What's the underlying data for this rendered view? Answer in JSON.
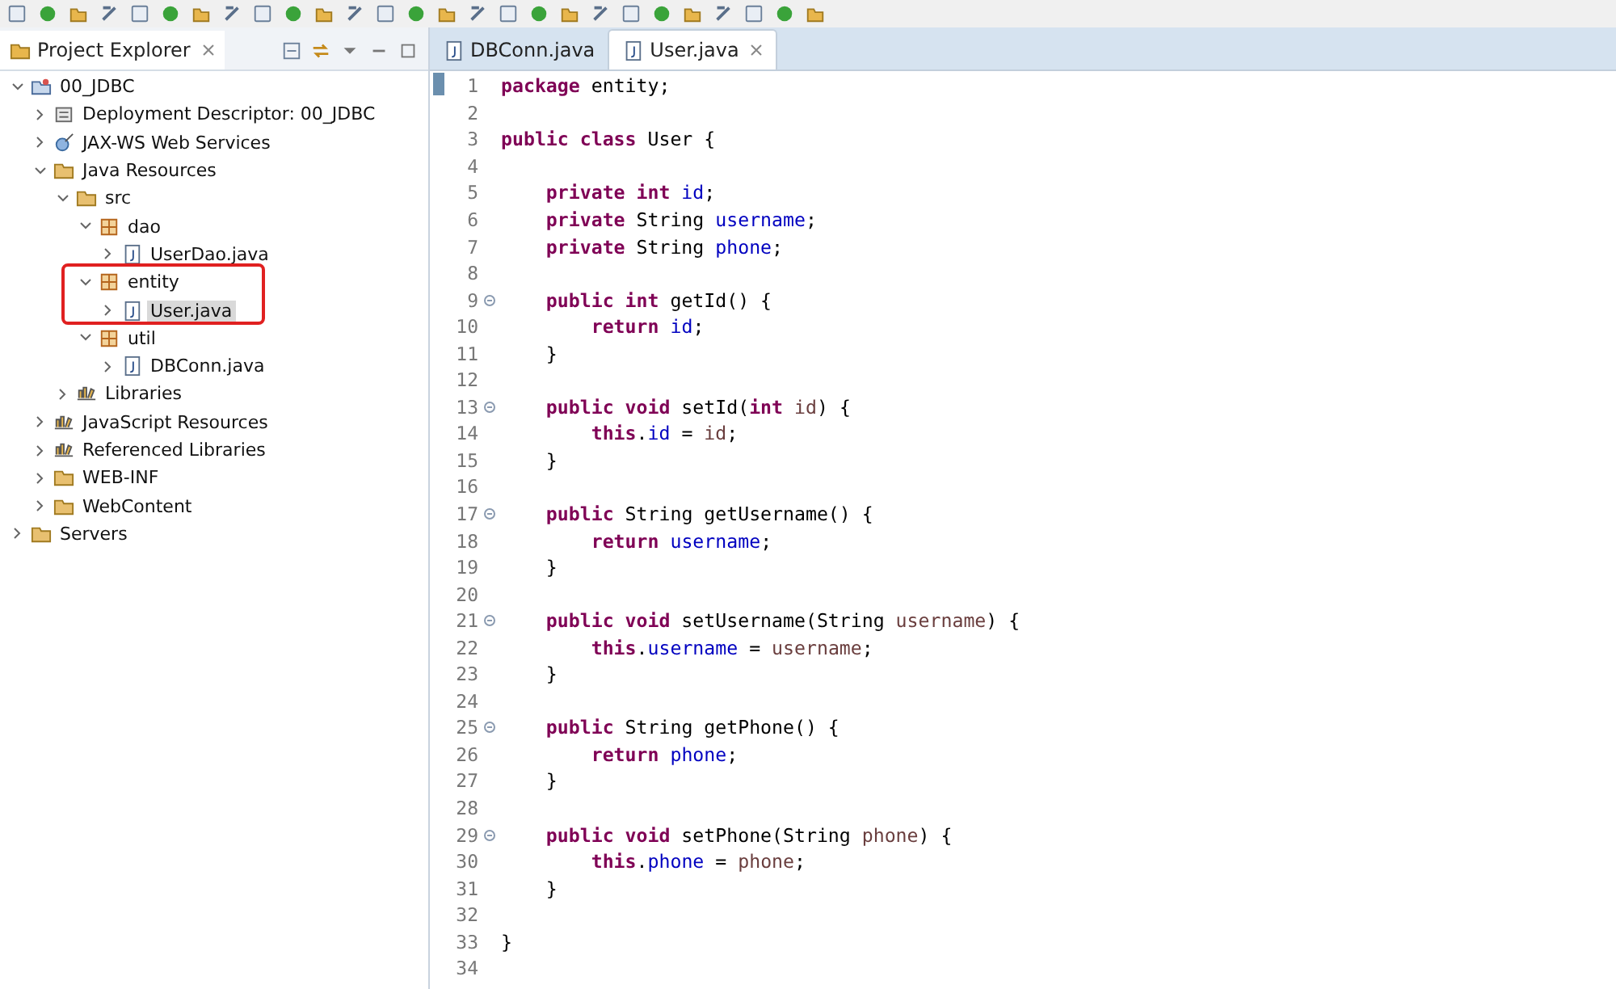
{
  "explorer": {
    "title": "Project Explorer",
    "tree": [
      {
        "label": "00_JDBC",
        "kind": "project",
        "expanded": true,
        "selected": false,
        "children": [
          {
            "label": "Deployment Descriptor: 00_JDBC",
            "kind": "descriptor",
            "expanded": false,
            "selected": false
          },
          {
            "label": "JAX-WS Web Services",
            "kind": "webservice",
            "expanded": false,
            "selected": false
          },
          {
            "label": "Java Resources",
            "kind": "folder",
            "expanded": true,
            "selected": false,
            "children": [
              {
                "label": "src",
                "kind": "folder",
                "expanded": true,
                "selected": false,
                "children": [
                  {
                    "label": "dao",
                    "kind": "package",
                    "expanded": true,
                    "selected": false,
                    "children": [
                      {
                        "label": "UserDao.java",
                        "kind": "file",
                        "expanded": false,
                        "selected": false
                      }
                    ]
                  },
                  {
                    "label": "entity",
                    "kind": "package",
                    "expanded": true,
                    "selected": false,
                    "children": [
                      {
                        "label": "User.java",
                        "kind": "file",
                        "expanded": false,
                        "selected": true
                      }
                    ]
                  },
                  {
                    "label": "util",
                    "kind": "package",
                    "expanded": true,
                    "selected": false,
                    "children": [
                      {
                        "label": "DBConn.java",
                        "kind": "file",
                        "expanded": false,
                        "selected": false
                      }
                    ]
                  }
                ]
              },
              {
                "label": "Libraries",
                "kind": "library",
                "expanded": false,
                "selected": false
              }
            ]
          },
          {
            "label": "JavaScript Resources",
            "kind": "library",
            "expanded": false,
            "selected": false
          },
          {
            "label": "Referenced Libraries",
            "kind": "library",
            "expanded": false,
            "selected": false
          },
          {
            "label": "WEB-INF",
            "kind": "folder",
            "expanded": false,
            "selected": false
          },
          {
            "label": "WebContent",
            "kind": "folder",
            "expanded": false,
            "selected": false
          }
        ]
      },
      {
        "label": "Servers",
        "kind": "folder",
        "expanded": false,
        "selected": false
      }
    ]
  },
  "editor": {
    "tabs": [
      {
        "label": "DBConn.java",
        "selected": false
      },
      {
        "label": "User.java",
        "selected": true
      }
    ],
    "lines": [
      {
        "n": "1",
        "fold": false,
        "segs": [
          {
            "t": "package",
            "kind": "kw"
          },
          {
            "t": " entity;",
            "kind": "plain"
          }
        ]
      },
      {
        "n": "2",
        "fold": false
      },
      {
        "n": "3",
        "fold": false,
        "segs": [
          {
            "t": "public class",
            "kind": "kw"
          },
          {
            "t": " User {",
            "kind": "plain"
          }
        ]
      },
      {
        "n": "4",
        "fold": false
      },
      {
        "n": "5",
        "fold": false,
        "segs": [
          {
            "t": "    private int",
            "kind": "kw"
          },
          {
            "t": " id",
            "kind": "field"
          },
          {
            "t": ";",
            "kind": "plain"
          }
        ]
      },
      {
        "n": "6",
        "fold": false,
        "segs": [
          {
            "t": "    private",
            "kind": "kw"
          },
          {
            "t": " String",
            "kind": "plain"
          },
          {
            "t": " username",
            "kind": "field"
          },
          {
            "t": ";",
            "kind": "plain"
          }
        ]
      },
      {
        "n": "7",
        "fold": false,
        "segs": [
          {
            "t": "    private",
            "kind": "kw"
          },
          {
            "t": " String",
            "kind": "plain"
          },
          {
            "t": " phone",
            "kind": "field"
          },
          {
            "t": ";",
            "kind": "plain"
          }
        ]
      },
      {
        "n": "8",
        "fold": false
      },
      {
        "n": "9",
        "fold": true,
        "segs": [
          {
            "t": "    public int",
            "kind": "kw"
          },
          {
            "t": " getId() {",
            "kind": "plain"
          }
        ]
      },
      {
        "n": "10",
        "fold": false,
        "segs": [
          {
            "t": "        return",
            "kind": "kw"
          },
          {
            "t": " id",
            "kind": "field"
          },
          {
            "t": ";",
            "kind": "plain"
          }
        ]
      },
      {
        "n": "11",
        "fold": false,
        "segs": [
          {
            "t": "    }",
            "kind": "plain"
          }
        ]
      },
      {
        "n": "12",
        "fold": false
      },
      {
        "n": "13",
        "fold": true,
        "segs": [
          {
            "t": "    public void",
            "kind": "kw"
          },
          {
            "t": " setId(",
            "kind": "plain"
          },
          {
            "t": "int",
            "kind": "kw"
          },
          {
            "t": " id",
            "kind": "param"
          },
          {
            "t": ") {",
            "kind": "plain"
          }
        ]
      },
      {
        "n": "14",
        "fold": false,
        "segs": [
          {
            "t": "        this",
            "kind": "kw"
          },
          {
            "t": ".",
            "kind": "plain"
          },
          {
            "t": "id",
            "kind": "field"
          },
          {
            "t": " =",
            "kind": "plain"
          },
          {
            "t": " id",
            "kind": "param"
          },
          {
            "t": ";",
            "kind": "plain"
          }
        ]
      },
      {
        "n": "15",
        "fold": false,
        "segs": [
          {
            "t": "    }",
            "kind": "plain"
          }
        ]
      },
      {
        "n": "16",
        "fold": false
      },
      {
        "n": "17",
        "fold": true,
        "segs": [
          {
            "t": "    public",
            "kind": "kw"
          },
          {
            "t": " String getUsername() {",
            "kind": "plain"
          }
        ]
      },
      {
        "n": "18",
        "fold": false,
        "segs": [
          {
            "t": "        return",
            "kind": "kw"
          },
          {
            "t": " username",
            "kind": "field"
          },
          {
            "t": ";",
            "kind": "plain"
          }
        ]
      },
      {
        "n": "19",
        "fold": false,
        "segs": [
          {
            "t": "    }",
            "kind": "plain"
          }
        ]
      },
      {
        "n": "20",
        "fold": false
      },
      {
        "n": "21",
        "fold": true,
        "segs": [
          {
            "t": "    public void",
            "kind": "kw"
          },
          {
            "t": " setUsername(String",
            "kind": "plain"
          },
          {
            "t": " username",
            "kind": "param"
          },
          {
            "t": ") {",
            "kind": "plain"
          }
        ]
      },
      {
        "n": "22",
        "fold": false,
        "segs": [
          {
            "t": "        this",
            "kind": "kw"
          },
          {
            "t": ".",
            "kind": "plain"
          },
          {
            "t": "username",
            "kind": "field"
          },
          {
            "t": " =",
            "kind": "plain"
          },
          {
            "t": " username",
            "kind": "param"
          },
          {
            "t": ";",
            "kind": "plain"
          }
        ]
      },
      {
        "n": "23",
        "fold": false,
        "segs": [
          {
            "t": "    }",
            "kind": "plain"
          }
        ]
      },
      {
        "n": "24",
        "fold": false
      },
      {
        "n": "25",
        "fold": true,
        "segs": [
          {
            "t": "    public",
            "kind": "kw"
          },
          {
            "t": " String getPhone() {",
            "kind": "plain"
          }
        ]
      },
      {
        "n": "26",
        "fold": false,
        "segs": [
          {
            "t": "        return",
            "kind": "kw"
          },
          {
            "t": " phone",
            "kind": "field"
          },
          {
            "t": ";",
            "kind": "plain"
          }
        ]
      },
      {
        "n": "27",
        "fold": false,
        "segs": [
          {
            "t": "    }",
            "kind": "plain"
          }
        ]
      },
      {
        "n": "28",
        "fold": false
      },
      {
        "n": "29",
        "fold": true,
        "segs": [
          {
            "t": "    public void",
            "kind": "kw"
          },
          {
            "t": " setPhone(String",
            "kind": "plain"
          },
          {
            "t": " phone",
            "kind": "param"
          },
          {
            "t": ") {",
            "kind": "plain"
          }
        ]
      },
      {
        "n": "30",
        "fold": false,
        "segs": [
          {
            "t": "        this",
            "kind": "kw"
          },
          {
            "t": ".",
            "kind": "plain"
          },
          {
            "t": "phone",
            "kind": "field"
          },
          {
            "t": " =",
            "kind": "plain"
          },
          {
            "t": " phone",
            "kind": "param"
          },
          {
            "t": ";",
            "kind": "plain"
          }
        ]
      },
      {
        "n": "31",
        "fold": false,
        "segs": [
          {
            "t": "    }",
            "kind": "plain"
          }
        ]
      },
      {
        "n": "32",
        "fold": false
      },
      {
        "n": "33",
        "fold": false,
        "segs": [
          {
            "t": "}",
            "kind": "plain"
          }
        ]
      },
      {
        "n": "34",
        "fold": false
      }
    ]
  }
}
